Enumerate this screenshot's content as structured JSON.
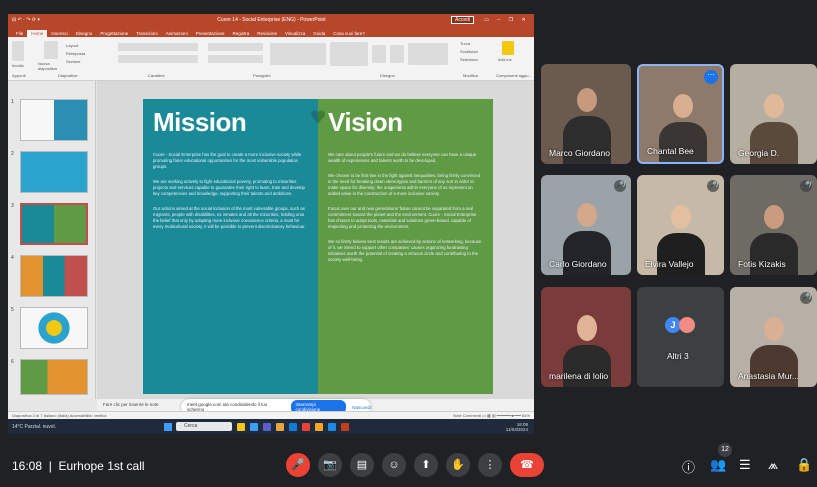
{
  "ppt": {
    "title": "Cuore 14 - Social Enterprise (ENG) - PowerPoint",
    "quick_access": "⊟ ↶ · ↷ ⟳ ▾",
    "account": "Accedi",
    "window_controls": [
      "▭",
      "–",
      "❐",
      "✕"
    ],
    "tabs": [
      "File",
      "Home",
      "Inserisci",
      "Disegno",
      "Progettazione",
      "Transizioni",
      "Animazioni",
      "Presentazione",
      "Registra",
      "Revisione",
      "Visualizza",
      "Guida",
      "Cosa vuoi fare?"
    ],
    "ribbon_groups": [
      "Appunti",
      "Diapositive",
      "Carattere",
      "Paragrafo",
      "Disegno",
      "Modifica",
      "Componenti aggiu..."
    ],
    "ribbon_labels": {
      "incolla": "Incolla",
      "nuova": "Nuova diapositiva",
      "layout": "Layout",
      "reimposta": "Reimposta",
      "sezione": "Sezione",
      "trova": "Trova",
      "sostituisci": "Sostituisci",
      "seleziona": "Seleziona",
      "addins": "Add-ins"
    },
    "thumb_numbers": [
      "1",
      "2",
      "3",
      "4",
      "5",
      "6"
    ],
    "slide": {
      "mission_title": "Mission",
      "vision_title": "Vision",
      "mission_paras": [
        "Cuore - Social Enterprise has the goal to create a more inclusive society while promoting fairer educational opportunities for the most vulnerable population groups.",
        "We are working actively to fight educational poverty, promoting to minorities projects and services capable to guarantee their right to learn, train and develop key competencies and knowledge, supporting their talents and ambitions.",
        "Our actions aimed at the social inclusion of the most vulnerable groups, such as migrants, people with disabilities, ex inmates and all the minorities, holding onto the belief that only by adopting more inclusive coexistence criteria, a must for every multicultural society, it will be possible to prevent discriminatory behaviour."
      ],
      "vision_paras": [
        "We care about people's future and we do believe everyone can have a unique wealth of experiences and talents worth to be developed.",
        "We choose to be first-line in the fight against inequalities, being firmly convinced in the need for breaking down stereotypes and barriers of any sort in order to make space for diversity; the uniqueness within everyone of us represent an added value in the construction of a more inclusive society.",
        "Focus over our and new generations' future cannot be separated from a real commitment toward the planet and the environment. Cuore - Social Enterprise has chosen to adopt tools, materials and solutions green-based, capable of respecting and protecting the environment.",
        "We so firmly believe best results are achieved by actions of networking, because of it, we intend to support other companies' causes organizing fundraising initiatives worth the potential of creating a virtuous circle and contributing to the society well-being."
      ]
    },
    "notes_placeholder": "Fare clic per inserire le note",
    "status_left": "Diapositiva 3 di 7   Italiano (Italia)   Accessibilità: verifica",
    "status_right": "Note   Commenti   ▭ ▦ ▤   ━━━━━━●━━━   84%",
    "share": {
      "text": "meet.google.com sta condividendo il tuo schermo",
      "stop": "Interrompi condivisione",
      "hide": "Nascondi"
    },
    "taskbar": {
      "weather": "14°C Parzial. nuvol.",
      "search": "Cerca",
      "time": "16:08",
      "date": "11/03/2024"
    }
  },
  "participants": [
    {
      "name": "Marco Giordano",
      "muted": false,
      "active": false
    },
    {
      "name": "Chantal Bee",
      "muted": false,
      "active": true
    },
    {
      "name": "Georgia D.",
      "muted": false,
      "active": false
    },
    {
      "name": "Carlo Giordano",
      "muted": true,
      "active": false
    },
    {
      "name": "Elvira Vallejo",
      "muted": true,
      "active": false
    },
    {
      "name": "Fotis Kizakis",
      "muted": true,
      "active": false
    },
    {
      "name": "marilena di lolio",
      "muted": false,
      "active": false
    },
    {
      "name": "Altri 3",
      "muted": false,
      "active": false
    },
    {
      "name": "Anastasia Mur...",
      "muted": true,
      "active": false
    }
  ],
  "others": {
    "label": "Altri 3",
    "avatar1": "J",
    "avatar1_color": "#4285f4",
    "avatar2_color": "#f28b82"
  },
  "meet": {
    "time": "16:08",
    "meeting_name": "Eurhope 1st call",
    "participant_count": "12",
    "more_icon": "⋯",
    "mute_glyph": "🎤̸",
    "controls": [
      "🎤",
      "📷",
      "▤",
      "☺",
      "⬆",
      "✋",
      "⋮",
      "☎"
    ],
    "right_icons": [
      "ⓘ",
      "👥",
      "☰",
      "⩕",
      "🔒"
    ]
  },
  "colors": {
    "mission": "#1a8a97",
    "vision": "#5f9a45",
    "ppt_accent": "#b7472a",
    "meet_bg": "#202124",
    "hangup": "#ea4335"
  }
}
